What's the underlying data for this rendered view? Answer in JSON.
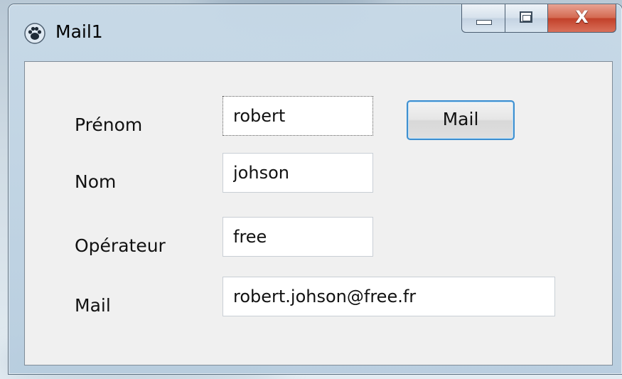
{
  "window": {
    "title": "Mail1",
    "app_icon": "paw-icon",
    "controls": {
      "minimize": "minimize-icon",
      "maximize": "maximize-icon",
      "close_label": "X"
    }
  },
  "form": {
    "prenom": {
      "label": "Prénom",
      "value": "robert"
    },
    "nom": {
      "label": "Nom",
      "value": "johson"
    },
    "operateur": {
      "label": "Opérateur",
      "value": "free"
    },
    "mail": {
      "label": "Mail",
      "value": "robert.johson@free.fr"
    },
    "mail_button_label": "Mail"
  },
  "colors": {
    "close_button": "#c2412a",
    "focus_border": "#3d8fd0",
    "client_bg": "#f0f0f0"
  }
}
